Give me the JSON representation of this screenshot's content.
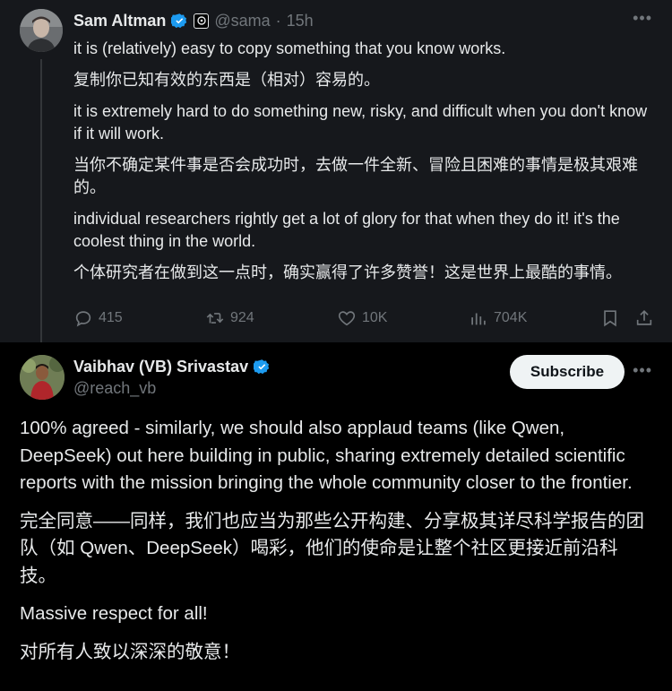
{
  "quoted_tweet": {
    "author_name": "Sam Altman",
    "author_handle": "@sama",
    "separator": "·",
    "timestamp": "15h",
    "more_icon": "more-icon",
    "paragraphs": [
      "it is (relatively) easy to copy something that you know works.",
      "复制你已知有效的东西是（相对）容易的。",
      "it is extremely hard to do something new, risky, and difficult when you don't know if it will work.",
      "当你不确定某件事是否会成功时，去做一件全新、冒险且困难的事情是极其艰难的。",
      "individual researchers rightly get a lot of glory for that when they do it! it's the coolest thing in the world.",
      "个体研究者在做到这一点时，确实赢得了许多赞誉！这是世界上最酷的事情。"
    ],
    "actions": {
      "replies": "415",
      "reposts": "924",
      "likes": "10K",
      "views": "704K"
    }
  },
  "main_tweet": {
    "author_name": "Vaibhav (VB) Srivastav",
    "author_handle": "@reach_vb",
    "subscribe_label": "Subscribe",
    "paragraphs": [
      "100% agreed - similarly, we should also applaud teams (like Qwen, DeepSeek) out here building in public, sharing extremely detailed scientific reports with the mission bringing the whole community closer to the frontier.",
      "完全同意——同样，我们也应当为那些公开构建、分享极其详尽科学报告的团队（如 Qwen、DeepSeek）喝彩，他们的使命是让整个社区更接近前沿科技。",
      "Massive respect for all!",
      "对所有人致以深深的敬意！"
    ]
  },
  "colors": {
    "background": "#000000",
    "quoted_background": "#16181c",
    "text": "#e7e9ea",
    "secondary_text": "#71767b",
    "verified_blue": "#1d9bf0"
  }
}
